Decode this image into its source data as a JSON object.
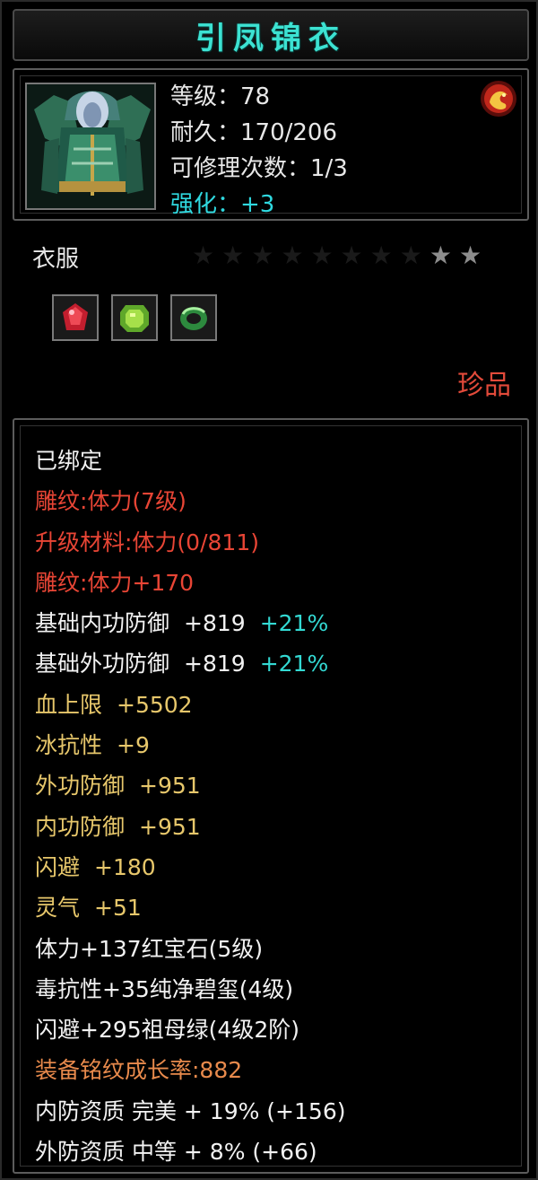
{
  "title": "引凤锦衣",
  "info": {
    "level": "等级：78",
    "durability": "耐久：170/206",
    "repairs": "可修理次数：1/3",
    "enhance": "强化：+3"
  },
  "category": "衣服",
  "stars": {
    "total": 10,
    "lit": 2
  },
  "gems": [
    {
      "icon": "ruby-gem-icon",
      "color": "#d8283a"
    },
    {
      "icon": "peridot-gem-icon",
      "color": "#8fd138"
    },
    {
      "icon": "jade-ring-icon",
      "color": "#58c064"
    }
  ],
  "rarity": "珍品",
  "attrs": {
    "bound": "已绑定",
    "carve1": "雕纹:体力(7级)",
    "upgrade": "升级材料:体力(0/811)",
    "carve2": "雕纹:体力+170",
    "base_inner_label": "基础内功防御",
    "base_inner_value": "+819",
    "base_inner_pct": "+21%",
    "base_outer_label": "基础外功防御",
    "base_outer_value": "+819",
    "base_outer_pct": "+21%",
    "hp_label": "血上限",
    "hp_value": "+5502",
    "ice_label": "冰抗性",
    "ice_value": "+9",
    "outer_def_label": "外功防御",
    "outer_def_value": "+951",
    "inner_def_label": "内功防御",
    "inner_def_value": "+951",
    "dodge_label": "闪避",
    "dodge_value": "+180",
    "spirit_label": "灵气",
    "spirit_value": "+51",
    "gem1": "体力+137红宝石(5级)",
    "gem2": "毒抗性+35纯净碧玺(4级)",
    "gem3": "闪避+295祖母绿(4级2阶)",
    "growth": "装备铭纹成长率:882",
    "inner_quality": "内防资质 完美 + 19% (+156)",
    "outer_quality": "外防资质 中等 + 8% (+66)"
  }
}
